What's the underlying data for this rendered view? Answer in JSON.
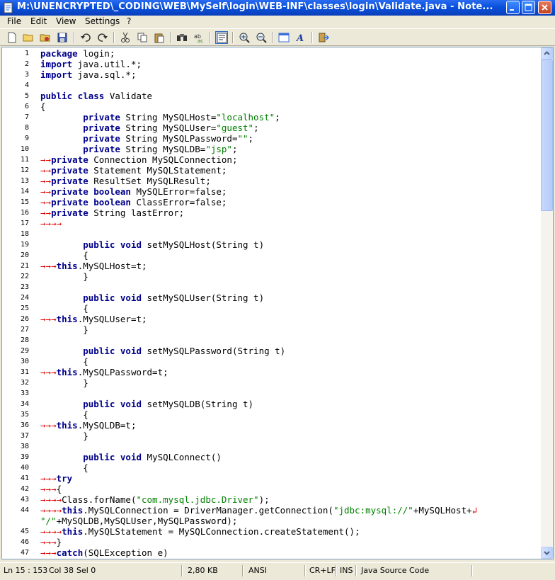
{
  "window": {
    "title": "M:\\UNENCRYPTED\\_CODING\\WEB\\MySelf\\login\\WEB-INF\\classes\\login\\Validate.java - Note..."
  },
  "menu": {
    "file": "File",
    "edit": "Edit",
    "view": "View",
    "settings": "Settings",
    "help": "?"
  },
  "toolbar_icons": [
    "new-icon",
    "open-icon",
    "favorites-icon",
    "save-icon",
    "undo-icon",
    "redo-icon",
    "cut-icon",
    "copy-icon",
    "paste-icon",
    "find-icon",
    "replace-icon",
    "word-wrap-icon",
    "zoom-in-icon",
    "zoom-out-icon",
    "view-icon",
    "font-icon",
    "exit-icon"
  ],
  "editor": {
    "lines": [
      {
        "n": "1",
        "t": "package login;"
      },
      {
        "n": "2",
        "t": "import java.util.*;"
      },
      {
        "n": "3",
        "t": "import java.sql.*;"
      },
      {
        "n": "4",
        "t": ""
      },
      {
        "n": "5",
        "t": "public class Validate"
      },
      {
        "n": "6",
        "t": "{"
      },
      {
        "n": "7",
        "t": "        private String MySQLHost=\"localhost\";"
      },
      {
        "n": "8",
        "t": "        private String MySQLUser=\"guest\";"
      },
      {
        "n": "9",
        "t": "        private String MySQLPassword=\"\";"
      },
      {
        "n": "10",
        "t": "        private String MySQLDB=\"jsp\";"
      },
      {
        "n": "11",
        "t": "→→private Connection MySQLConnection;"
      },
      {
        "n": "12",
        "t": "→→private Statement MySQLStatement;"
      },
      {
        "n": "13",
        "t": "→→private ResultSet MySQLResult;"
      },
      {
        "n": "14",
        "t": "→→private boolean MySQLError=false;"
      },
      {
        "n": "15",
        "t": "→→private boolean ClassError=false;"
      },
      {
        "n": "16",
        "t": "→→private String lastError;"
      },
      {
        "n": "17",
        "t": "→→→→"
      },
      {
        "n": "18",
        "t": ""
      },
      {
        "n": "19",
        "t": "        public void setMySQLHost(String t)"
      },
      {
        "n": "20",
        "t": "        {"
      },
      {
        "n": "21",
        "t": "→→→this.MySQLHost=t;"
      },
      {
        "n": "22",
        "t": "        }"
      },
      {
        "n": "23",
        "t": ""
      },
      {
        "n": "24",
        "t": "        public void setMySQLUser(String t)"
      },
      {
        "n": "25",
        "t": "        {"
      },
      {
        "n": "26",
        "t": "→→→this.MySQLUser=t;"
      },
      {
        "n": "27",
        "t": "        }"
      },
      {
        "n": "28",
        "t": ""
      },
      {
        "n": "29",
        "t": "        public void setMySQLPassword(String t)"
      },
      {
        "n": "30",
        "t": "        {"
      },
      {
        "n": "31",
        "t": "→→→this.MySQLPassword=t;"
      },
      {
        "n": "32",
        "t": "        }"
      },
      {
        "n": "33",
        "t": ""
      },
      {
        "n": "34",
        "t": "        public void setMySQLDB(String t)"
      },
      {
        "n": "35",
        "t": "        {"
      },
      {
        "n": "36",
        "t": "→→→this.MySQLDB=t;"
      },
      {
        "n": "37",
        "t": "        }"
      },
      {
        "n": "38",
        "t": ""
      },
      {
        "n": "39",
        "t": "        public void MySQLConnect()"
      },
      {
        "n": "40",
        "t": "        {"
      },
      {
        "n": "41",
        "t": "→→→try"
      },
      {
        "n": "42",
        "t": "→→→{"
      },
      {
        "n": "43",
        "t": "→→→→Class.forName(\"com.mysql.jdbc.Driver\");"
      },
      {
        "n": "44",
        "t": "→→→→this.MySQLConnection = DriverManager.getConnection(\"jdbc:mysql://\"+MySQLHost+↲"
      },
      {
        "n": "",
        "t": "\"/\"+MySQLDB,MySQLUser,MySQLPassword);"
      },
      {
        "n": "45",
        "t": "→→→→this.MySQLStatement = MySQLConnection.createStatement();"
      },
      {
        "n": "46",
        "t": "→→→}"
      },
      {
        "n": "47",
        "t": "→→→catch(SQLException e)"
      }
    ]
  },
  "status": {
    "position": "Ln 15 : 153",
    "col": "Col 38",
    "sel": "Sel 0",
    "size": "2,80 KB",
    "encoding": "ANSI",
    "eol": "CR+LF",
    "mode": "INS",
    "scheme": "Java Source Code"
  }
}
